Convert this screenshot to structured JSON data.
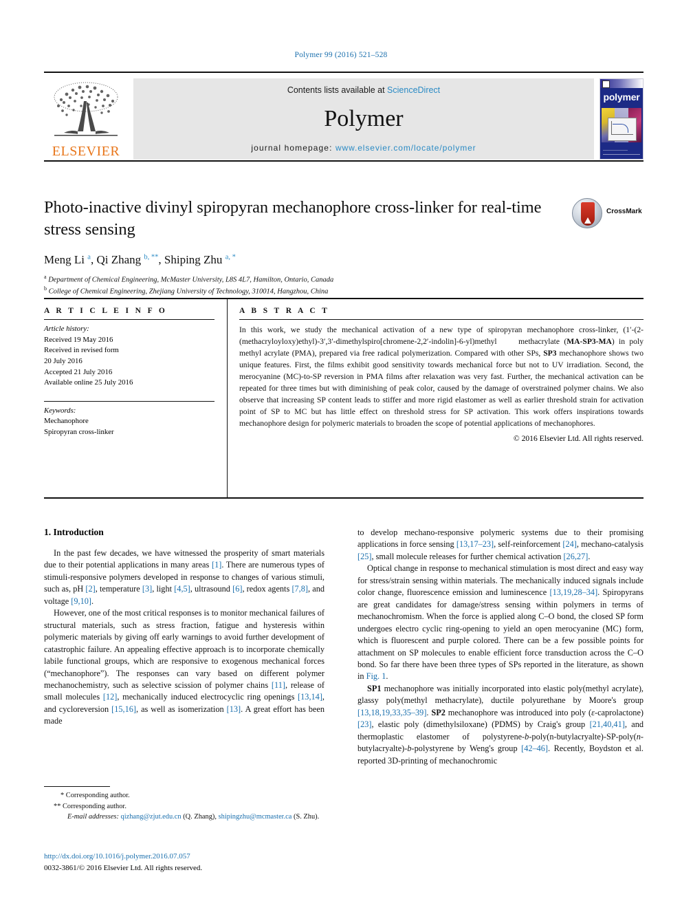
{
  "running_head": "Polymer 99 (2016) 521–528",
  "masthead": {
    "publisher": "ELSEVIER",
    "contents_prefix": "Contents lists available at ",
    "contents_link": "ScienceDirect",
    "journal_name": "Polymer",
    "homepage_prefix": "journal homepage: ",
    "homepage_url": "www.elsevier.com/locate/polymer",
    "cover_title": "polymer"
  },
  "article": {
    "title": "Photo-inactive divinyl spiropyran mechanophore cross-linker for real-time stress sensing",
    "crossmark_label": "CrossMark",
    "authors_html": "Meng Li <sup>a</sup>, Qi Zhang <sup>b, **</sup>, Shiping Zhu <sup>a, *</sup>",
    "affiliations": [
      "Department of Chemical Engineering, McMaster University, L8S 4L7, Hamilton, Ontario, Canada",
      "College of Chemical Engineering, Zhejiang University of Technology, 310014, Hangzhou, China"
    ],
    "affiliation_markers": [
      "a",
      "b"
    ]
  },
  "article_info": {
    "heading": "A R T I C L E   I N F O",
    "history_label": "Article history:",
    "history": [
      "Received 19 May 2016",
      "Received in revised form",
      "20 July 2016",
      "Accepted 21 July 2016",
      "Available online 25 July 2016"
    ],
    "keywords_label": "Keywords:",
    "keywords": [
      "Mechanophore",
      "Spiropyran cross-linker"
    ]
  },
  "abstract": {
    "heading": "A B S T R A C T",
    "text_html": "In this work, we study the mechanical activation of a new type of spiropyran mechanophore cross-linker, (1′-(2-(methacryloyloxy)ethyl)-3′,3′-dimethylspiro[chromene-2,2′-indolin]-6-yl)methyl&nbsp;&nbsp;&nbsp;&nbsp;&nbsp;methacrylate (<b>MA-SP3-MA</b>) in poly methyl acrylate (PMA), prepared via free radical polymerization. Compared with other SPs, <b>SP3</b> mechanophore shows two unique features. First, the films exhibit good sensitivity towards mechanical force but not to UV irradiation. Second, the merocyanine (MC)-to-SP reversion in PMA films after relaxation was very fast. Further, the mechanical activation can be repeated for three times but with diminishing of peak color, caused by the damage of overstrained polymer chains. We also observe that increasing SP content leads to stiffer and more rigid elastomer as well as earlier threshold strain for activation point of SP to MC but has little effect on threshold stress for SP activation. This work offers inspirations towards mechanophore design for polymeric materials to broaden the scope of potential applications of mechanophores.",
    "copyright": "© 2016 Elsevier Ltd. All rights reserved."
  },
  "body": {
    "section_heading": "1. Introduction",
    "left_paragraphs_html": [
      "In the past few decades, we have witnessed the prosperity of smart materials due to their potential applications in many areas <span class=\"ref\">[1]</span>. There are numerous types of stimuli-responsive polymers developed in response to changes of various stimuli, such as, pH <span class=\"ref\">[2]</span>, temperature <span class=\"ref\">[3]</span>, light <span class=\"ref\">[4,5]</span>, ultrasound <span class=\"ref\">[6]</span>, redox agents <span class=\"ref\">[7,8]</span>, and voltage <span class=\"ref\">[9,10]</span>.",
      "However, one of the most critical responses is to monitor mechanical failures of structural materials, such as stress fraction, fatigue and hysteresis within polymeric materials by giving off early warnings to avoid further development of catastrophic failure. An appealing effective approach is to incorporate chemically labile functional groups, which are responsive to exogenous mechanical forces (“mechanophore”). The responses can vary based on different polymer mechanochemistry, such as selective scission of polymer chains <span class=\"ref\">[11]</span>, release of small molecules <span class=\"ref\">[12]</span>, mechanically induced electrocyclic ring openings <span class=\"ref\">[13,14]</span>, and cycloreversion <span class=\"ref\">[15,16]</span>, as well as isomerization <span class=\"ref\">[13]</span>. A great effort has been made"
    ],
    "right_paragraphs_html": [
      "to develop mechano-responsive polymeric systems due to their promising applications in force sensing <span class=\"ref\">[13,17–23]</span>, self-reinforcement <span class=\"ref\">[24]</span>, mechano-catalysis <span class=\"ref\">[25]</span>, small molecule releases for further chemical activation <span class=\"ref\">[26,27]</span>.",
      "Optical change in response to mechanical stimulation is most direct and easy way for stress/strain sensing within materials. The mechanically induced signals include color change, fluorescence emission and luminescence <span class=\"ref\">[13,19,28–34]</span>. Spiropyrans are great candidates for damage/stress sensing within polymers in terms of mechanochromism. When the force is applied along C–O bond, the closed SP form undergoes electro cyclic ring-opening to yield an open merocyanine (MC) form, which is fluorescent and purple colored. There can be a few possible points for attachment on SP molecules to enable efficient force transduction across the C–O bond. So far there have been three types of SPs reported in the literature, as shown in <span class=\"ref\">Fig. 1</span>.",
      "<span class=\"bold\">SP1</span> mechanophore was initially incorporated into elastic poly(methyl acrylate), glassy poly(methyl methacrylate), ductile polyurethane by Moore's group <span class=\"ref\">[13,18,19,33,35–39]</span>. <span class=\"bold\">SP2</span> mechanophore was introduced into poly (<span class=\"ital\">ε</span>-caprolactone) <span class=\"ref\">[23]</span>, elastic poly (dimethylsiloxane) (PDMS) by Craig's group <span class=\"ref\">[21,40,41]</span>, and thermoplastic elastomer of polystyrene-<span class=\"ital\">b</span>-poly(n-butylacryalte)-SP-poly(<span class=\"ital\">n</span>-butylacryalte)-<span class=\"ital\">b</span>-polystyrene by Weng's group <span class=\"ref\">[42–46]</span>. Recently, Boydston et al. reported 3D-printing of mechanochromic"
    ]
  },
  "footnotes": {
    "corresponding_1": "* Corresponding author.",
    "corresponding_2": "** Corresponding author.",
    "email_label": "E-mail addresses:",
    "email_1": "qizhang@zjut.edu.cn",
    "email_1_name": "(Q. Zhang)",
    "email_2": "shipingzhu@mcmaster.ca",
    "email_2_name": "(S. Zhu)."
  },
  "footer": {
    "doi": "http://dx.doi.org/10.1016/j.polymer.2016.07.057",
    "issn_line": "0032-3861/© 2016 Elsevier Ltd. All rights reserved."
  }
}
